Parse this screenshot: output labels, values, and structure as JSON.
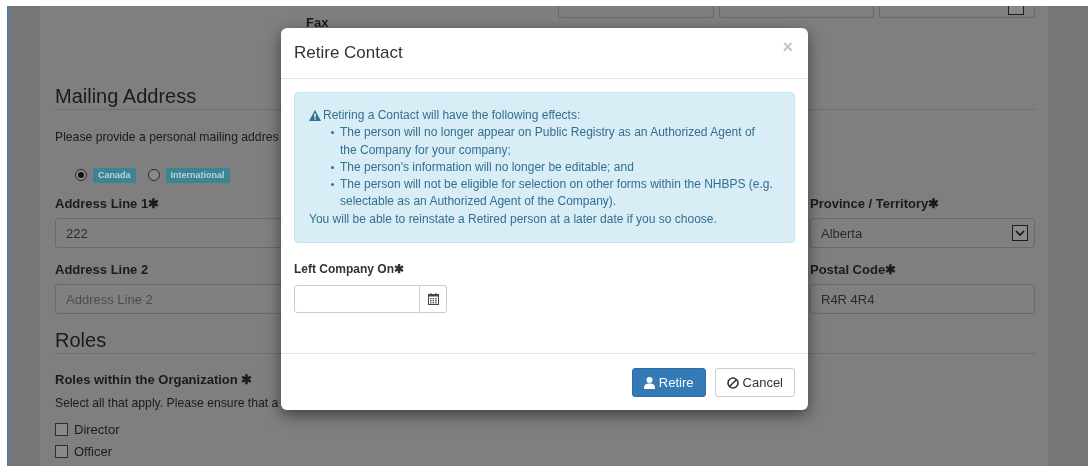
{
  "page": {
    "top_fields": [
      {
        "kind": "input"
      },
      {
        "kind": "input"
      },
      {
        "kind": "select"
      }
    ],
    "fax_label": "Fax",
    "mailing_address": {
      "heading": "Mailing Address",
      "instructions": "Please provide a personal mailing addres",
      "address_type": [
        {
          "label": "Canada",
          "selected": true
        },
        {
          "label": "International",
          "selected": false
        }
      ],
      "address_line_1": {
        "label": "Address Line 1✱",
        "value": "222"
      },
      "province_territory": {
        "label": "Province / Territory✱",
        "value": "Alberta"
      },
      "address_line_2": {
        "label": "Address Line 2",
        "placeholder": "Address Line 2"
      },
      "postal_code": {
        "label": "Postal Code✱",
        "value": "R4R 4R4"
      }
    },
    "roles": {
      "heading": "Roles",
      "label": "Roles within the Organization ✱",
      "instructions": "Select all that apply. Please ensure that a",
      "options": [
        {
          "label": "Director",
          "checked": false
        },
        {
          "label": "Officer",
          "checked": false
        }
      ]
    }
  },
  "modal": {
    "title": "Retire Contact",
    "close": "×",
    "alert": {
      "heading": "Retiring a Contact will have the following effects:",
      "items": [
        "The person will no longer appear on Public Registry as an Authorized Agent of the Company for your company;",
        "The person's information will no longer be editable; and",
        "The person will not be eligible for selection on other forms within the NHBPS (e.g. selectable as an Authorized Agent of the Company)."
      ],
      "note": "You will be able to reinstate a Retired person at a later date if you so choose."
    },
    "left_company_on": {
      "label": "Left Company On✱"
    },
    "buttons": [
      {
        "label": "Retire",
        "kind": "primary"
      },
      {
        "label": "Cancel",
        "kind": "default"
      }
    ]
  }
}
